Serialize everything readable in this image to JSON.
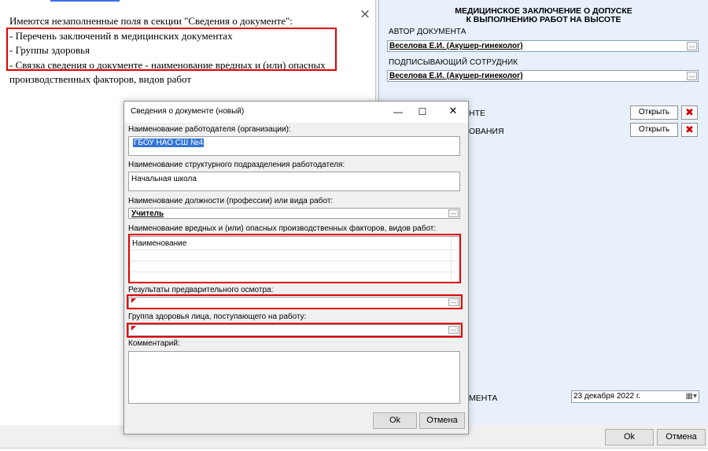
{
  "message": {
    "lines": [
      "Имеются незаполненные поля в секции \"Сведения о документе\":",
      "- Перечень заключений в медицинских документах",
      "- Группы здоровья",
      "- Связка сведения о документе - наименование вредных и (или) опасных",
      "производственных факторов, видов работ"
    ],
    "close_icon": "×"
  },
  "form": {
    "title_line1": "МЕДИЦИНСКОЕ ЗАКЛЮЧЕНИЕ О ДОПУСКЕ",
    "title_line2": "К ВЫПОЛНЕНИЮ РАБОТ НА ВЫСОТЕ",
    "author_label": "АВТОР ДОКУМЕНТА",
    "author_value": "Веселова Е.И. (Акушер-гинеколог)",
    "signer_label": "ПОДПИСЫВАЮЩИЙ СОТРУДНИК",
    "signer_value": "Веселова Е.И. (Акушер-гинеколог)",
    "row1_partial_label": "НТЕ",
    "row2_partial_label": "ОВАНИЯ",
    "open_label": "Открыть",
    "date_partial_label": "МЕНТА",
    "date_value": "23 декабря  2022 г.",
    "lookup_button": "..."
  },
  "dialog": {
    "title": "Сведения о документе (новый)",
    "minimize": "—",
    "maximize": "☐",
    "close": "✕",
    "employer_label": "Наименование работодателя (организации):",
    "employer_value": "ГБОУ НАО СШ №4",
    "division_label": "Наименование структурного подразделения работодателя:",
    "division_value": "Начальная школа",
    "position_label": "Наименование должности (профессии) или вида работ:",
    "position_value": "Учитель",
    "factors_label": "Наименование вредных и (или) опасных производственных факторов, видов работ:",
    "factors_header": "Наименование",
    "results_label": "Результаты предварительного осмотра:",
    "group_label": "Группа здоровья лица, поступающего на работу:",
    "comment_label": "Комментарий:",
    "ok": "Ok",
    "cancel": "Отмена"
  },
  "main_buttons": {
    "ok": "Ok",
    "cancel": "Отмена"
  },
  "colors": {
    "highlight": "#e00000",
    "selection": "#3476d6",
    "form_bg": "#e8f1fb"
  }
}
